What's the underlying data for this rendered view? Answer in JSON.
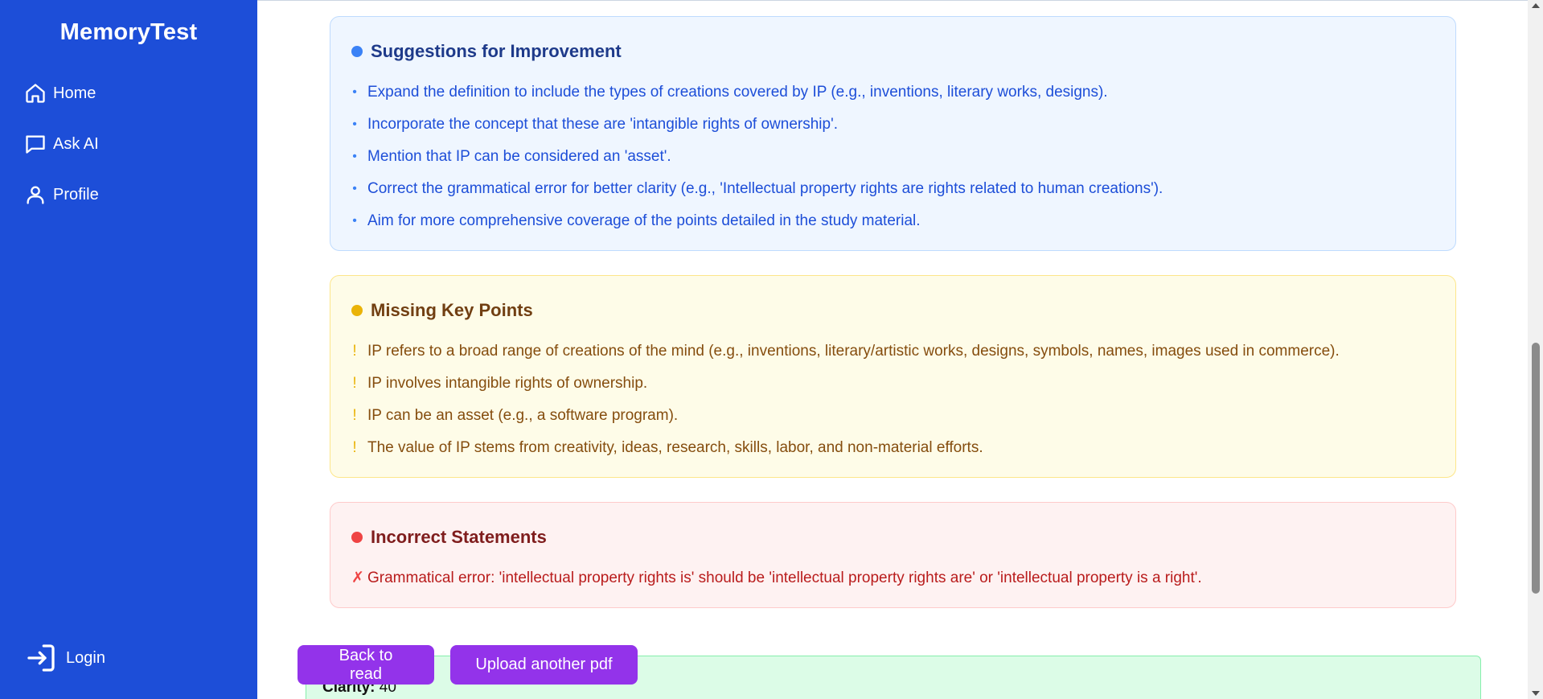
{
  "app": {
    "title": "MemoryTest"
  },
  "sidebar": {
    "items": [
      {
        "label": "Home",
        "icon": "home-icon"
      },
      {
        "label": "Ask AI",
        "icon": "chat-icon"
      },
      {
        "label": "Profile",
        "icon": "user-icon"
      }
    ],
    "login": {
      "label": "Login",
      "icon": "login-icon"
    }
  },
  "suggestions": {
    "title": "Suggestions for Improvement",
    "color": "#3b82f6",
    "items": [
      "Expand the definition to include the types of creations covered by IP (e.g., inventions, literary works, designs).",
      "Incorporate the concept that these are 'intangible rights of ownership'.",
      "Mention that IP can be considered an 'asset'.",
      "Correct the grammatical error for better clarity (e.g., 'Intellectual property rights are rights related to human creations').",
      "Aim for more comprehensive coverage of the points detailed in the study material."
    ]
  },
  "missing": {
    "title": "Missing Key Points",
    "color": "#eab308",
    "marker": "!",
    "items": [
      "IP refers to a broad range of creations of the mind (e.g., inventions, literary/artistic works, designs, symbols, names, images used in commerce).",
      "IP involves intangible rights of ownership.",
      "IP can be an asset (e.g., a software program).",
      "The value of IP stems from creativity, ideas, research, skills, labor, and non-material efforts."
    ]
  },
  "incorrect": {
    "title": "Incorrect Statements",
    "color": "#ef4444",
    "marker": "✗",
    "items": [
      "Grammatical error: 'intellectual property rights is' should be 'intellectual property rights are' or 'intellectual property is a right'."
    ]
  },
  "score": {
    "label": "Clarity:",
    "value": "40"
  },
  "actions": {
    "back_label": "Back to read",
    "upload_label": "Upload another pdf"
  }
}
